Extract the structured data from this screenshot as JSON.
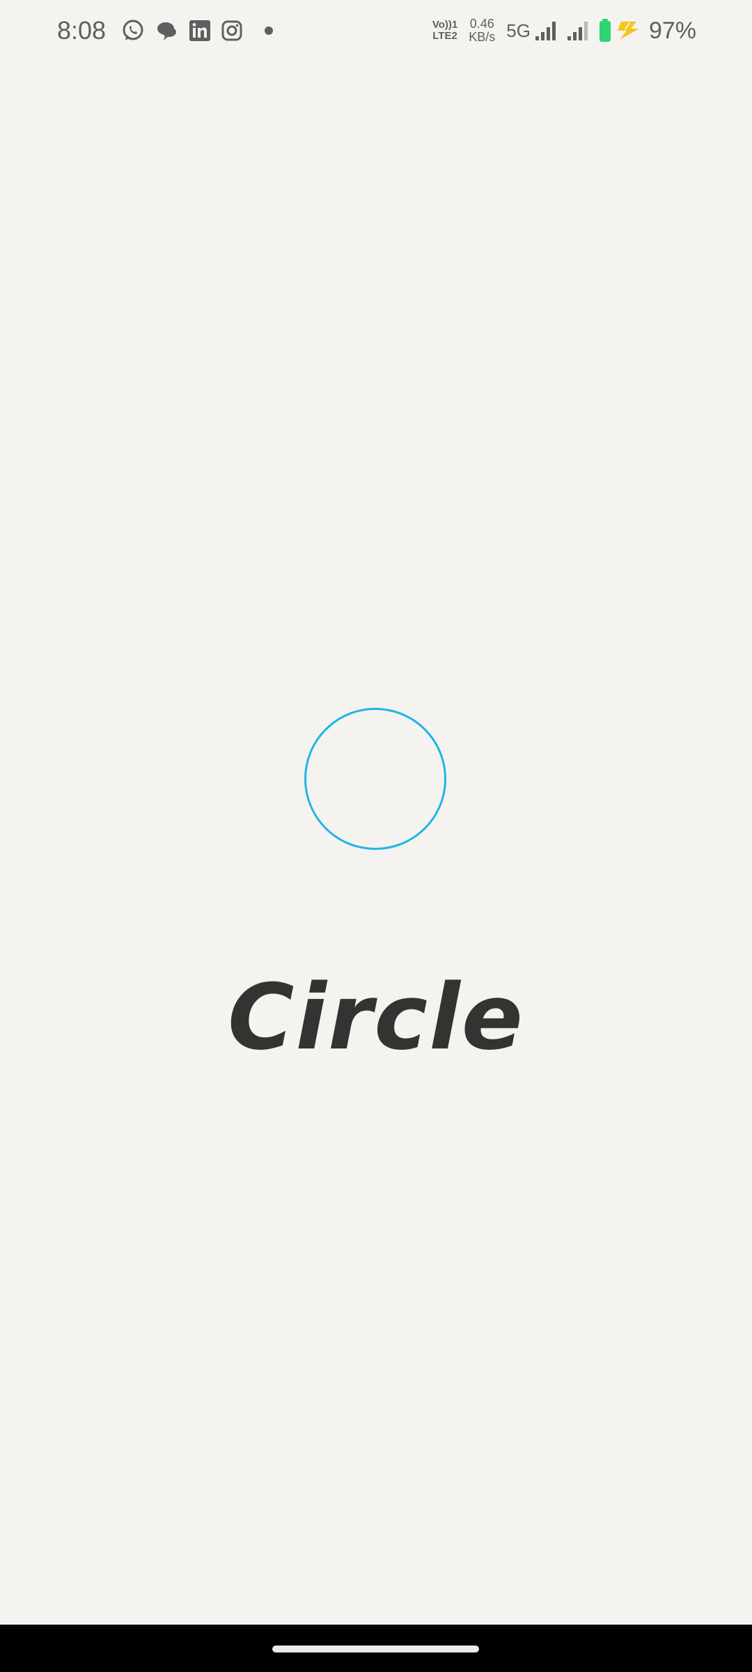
{
  "status_bar": {
    "time": "8:08",
    "notifications": [
      "whatsapp-icon",
      "chat-bubbles-icon",
      "linkedin-icon",
      "instagram-icon",
      "more-dot-icon"
    ],
    "volte_line1": "Vo))1",
    "volte_line2": "LTE2",
    "net_speed_value": "0.46",
    "net_speed_unit": "KB/s",
    "network": "5G",
    "battery_percent": "97%",
    "colors": {
      "text": "#5f5f5f",
      "battery_fill": "#2ed573",
      "charging_bolt": "#f5c518"
    }
  },
  "splash": {
    "app_name": "Circle",
    "loader_color": "#1fb5e6",
    "background": "#f4f3f0"
  },
  "navigation": {
    "handle": "home-gesture-handle"
  }
}
